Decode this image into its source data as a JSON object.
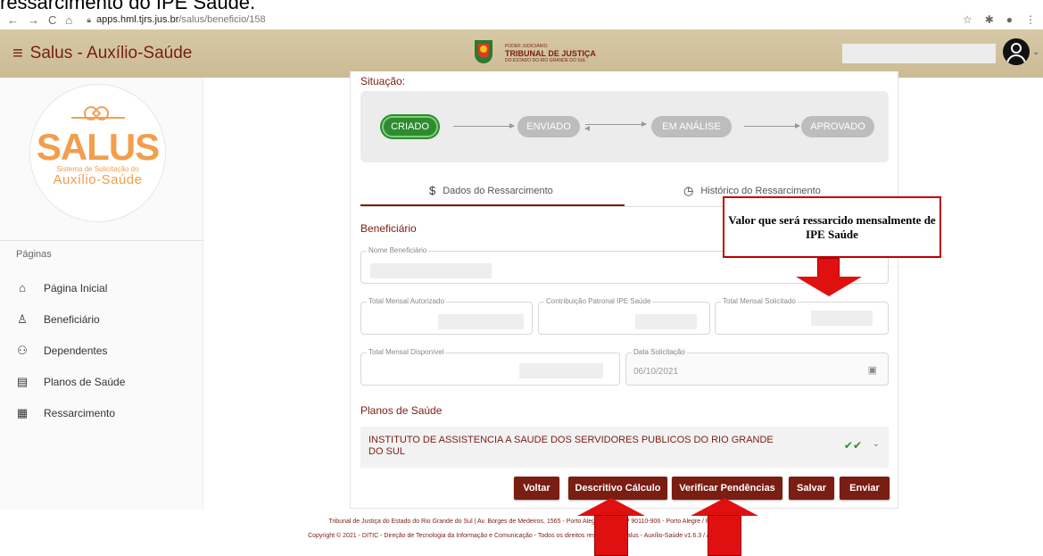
{
  "document": {
    "heading": "ressarcimento do IPE Saúde."
  },
  "browser": {
    "host": "apps.hml.tjrs.jus.br",
    "path": "/salus/beneficio/158"
  },
  "app": {
    "title": "Salus - Auxílio-Saúde",
    "court_small": "PODER JUDICIÁRIO",
    "court_big": "TRIBUNAL DE JUSTIÇA",
    "court_sub": "DO ESTADO DO RIO GRANDE DO SUL"
  },
  "sidebar": {
    "logo_word": "SALUS",
    "logo_sub1": "Sistema de Solicitação do",
    "logo_sub2": "Auxílio-Saúde",
    "section_label": "Páginas",
    "items": [
      {
        "label": "Página Inicial",
        "icon": "home-icon"
      },
      {
        "label": "Beneficiário",
        "icon": "person-icon"
      },
      {
        "label": "Dependentes",
        "icon": "people-icon"
      },
      {
        "label": "Planos de Saúde",
        "icon": "clipboard-icon"
      },
      {
        "label": "Ressarcimento",
        "icon": "receipt-icon"
      }
    ]
  },
  "situacao": {
    "label": "Situação:",
    "steps": [
      "CRIADO",
      "ENVIADO",
      "EM ANÁLISE",
      "APROVADO"
    ],
    "active_step": "CRIADO"
  },
  "tabs": [
    {
      "label": "Dados do Ressarcimento",
      "icon": "dollar-icon",
      "selected": true
    },
    {
      "label": "Histórico do Ressarcimento",
      "icon": "history-icon",
      "selected": false
    }
  ],
  "beneficiario": {
    "title": "Beneficiário",
    "nome_label": "Nome Beneficiário",
    "total_autorizado_label": "Total Mensal Autorizado",
    "contribuicao_label": "Contribuição Patronal IPE Saúde",
    "total_solicitado_label": "Total Mensal Solicitado",
    "total_disponivel_label": "Total Mensal Disponível",
    "data_label": "Data Solicitação",
    "data_value": "06/10/2021"
  },
  "planos": {
    "title": "Planos de Saúde",
    "plan_name": "INSTITUTO DE ASSISTENCIA A SAUDE DOS SERVIDORES PUBLICOS DO RIO GRANDE DO SUL"
  },
  "buttons": {
    "voltar": "Voltar",
    "descritivo": "Descritivo Cálculo",
    "verificar": "Verificar Pendências",
    "salvar": "Salvar",
    "enviar": "Enviar"
  },
  "footer": {
    "line1": "Tribunal de Justiça do Estado do Rio Grande do Sul | Av. Borges de Medeiros, 1565 - Porto Alegre/RS - CEP 90110-906 - Porto Alegre / RS",
    "line2": "Copyright © 2021 - DITIC - Direção de Tecnologia da Informação e Comunicação - Todos os direitos reservados - Salus - Auxílio-Saúde v1.6.3 / API v1.2.2"
  },
  "annotation": {
    "callout_text": "Valor que será ressarcido mensalmente de IPE Saúde"
  },
  "colors": {
    "brand": "#7a1d13",
    "appbar": "#cbbb93",
    "logo_orange": "#f29e4c",
    "active_green": "#2e8b2e",
    "annotation_red": "#e01010"
  }
}
